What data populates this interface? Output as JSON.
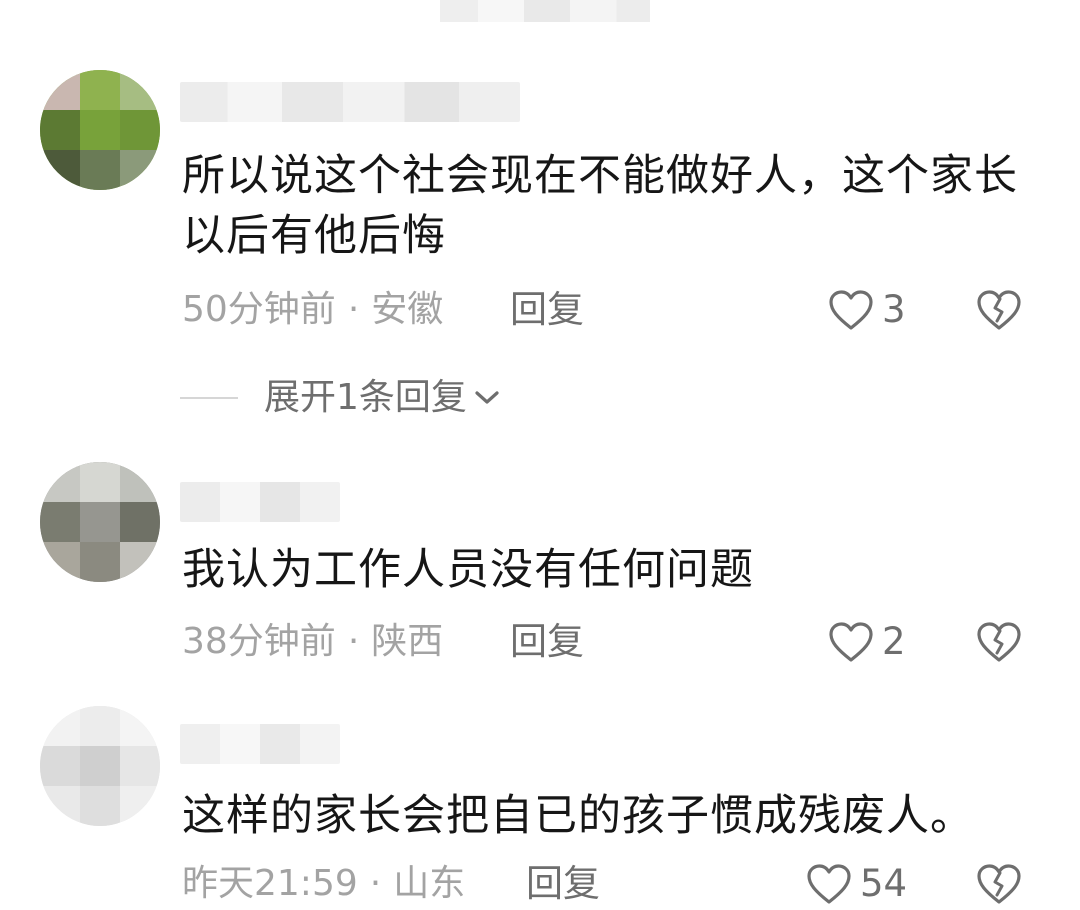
{
  "comments": [
    {
      "text": "所以说这个社会现在不能做好人，这个家长以后有他后悔",
      "time": "50分钟前",
      "location": "安徽",
      "reply_label": "回复",
      "likes": "3",
      "expand_label": "展开1条回复"
    },
    {
      "text": "我认为工作人员没有任何问题",
      "time": "38分钟前",
      "location": "陕西",
      "reply_label": "回复",
      "likes": "2"
    },
    {
      "text": "这样的家长会把自已的孩子惯成残废人。",
      "time": "昨天21:59",
      "location": "山东",
      "reply_label": "回复",
      "likes": "54"
    }
  ],
  "meta_separator": "·",
  "icons": {
    "like": "heart-outline-icon",
    "dislike": "broken-heart-icon",
    "expand": "chevron-down-icon"
  },
  "colors": {
    "text": "#161616",
    "meta": "#a3a3a3",
    "action": "#6e6e6e"
  }
}
